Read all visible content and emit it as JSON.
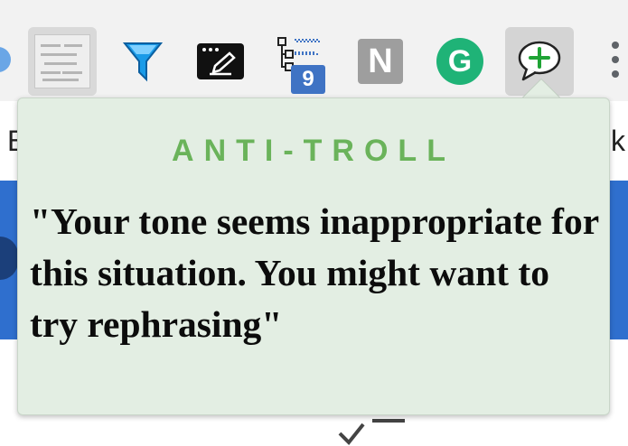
{
  "toolbar": {
    "icons": [
      {
        "name": "partial-circle-icon"
      },
      {
        "name": "screenshot-thumbnail-icon"
      },
      {
        "name": "filter-funnel-icon"
      },
      {
        "name": "pencil-note-icon"
      },
      {
        "name": "tree-structure-icon",
        "badge": "9"
      },
      {
        "name": "n-letter-icon",
        "label": "N"
      },
      {
        "name": "grammarly-g-icon",
        "label": "G"
      },
      {
        "name": "speech-bubble-plus-icon",
        "active": true
      },
      {
        "name": "more-vertical-icon"
      }
    ],
    "colors": {
      "badge": "#3f73c4",
      "grammarly": "#1fb377",
      "plus": "#1fa335"
    }
  },
  "background_page": {
    "left_letter": "B",
    "right_letter": "k",
    "bar_color": "#2f6fce"
  },
  "popup": {
    "title": "ANTI-TROLL",
    "message": "\"Your tone seems inappropriate for this situation. You might want to try rephrasing\"",
    "colors": {
      "background": "#e3eee3",
      "title": "#6ab35a",
      "text": "#0c0c0c"
    }
  }
}
